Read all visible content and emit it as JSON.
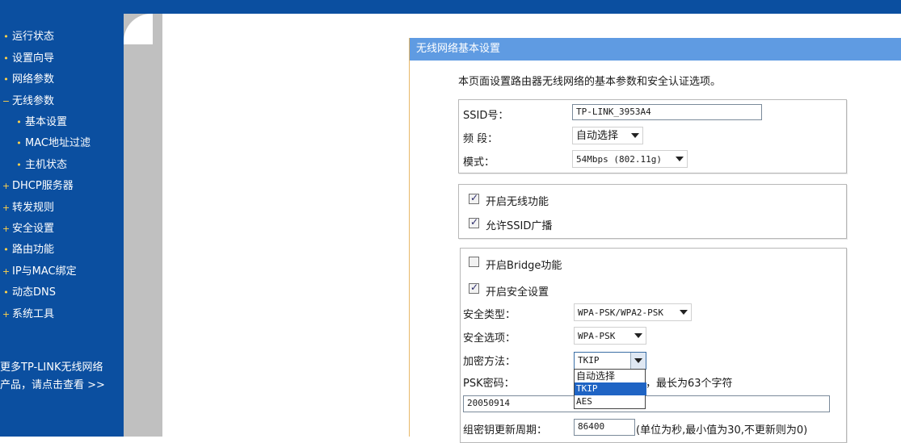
{
  "nav": {
    "items": [
      {
        "label": "运行状态",
        "marker": "•"
      },
      {
        "label": "设置向导",
        "marker": "•"
      },
      {
        "label": "网络参数",
        "marker": "•"
      },
      {
        "label": "无线参数",
        "marker": "−"
      },
      {
        "label": "基本设置",
        "marker": "•"
      },
      {
        "label": "MAC地址过滤",
        "marker": "•"
      },
      {
        "label": "主机状态",
        "marker": "•"
      },
      {
        "label": "DHCP服务器",
        "marker": "+"
      },
      {
        "label": "转发规则",
        "marker": "+"
      },
      {
        "label": "安全设置",
        "marker": "+"
      },
      {
        "label": "路由功能",
        "marker": "•"
      },
      {
        "label": "IP与MAC绑定",
        "marker": "+"
      },
      {
        "label": "动态DNS",
        "marker": "•"
      },
      {
        "label": "系统工具",
        "marker": "+"
      }
    ],
    "promo_line1": "更多TP-LINK无线网络",
    "promo_line2": "产品，请点击查看 >>"
  },
  "panel": {
    "title": "无线网络基本设置",
    "description": "本页面设置路由器无线网络的基本参数和安全认证选项。"
  },
  "basic": {
    "ssid_label": "SSID号：",
    "ssid_value": "TP-LINK_3953A4",
    "band_label": "频 段：",
    "band_value": "自动选择",
    "mode_label": "模式：",
    "mode_value": "54Mbps (802.11g)"
  },
  "wireless": {
    "enable_label": "开启无线功能",
    "enable_checked": true,
    "ssid_broadcast_label": "允许SSID广播",
    "ssid_broadcast_checked": true
  },
  "security": {
    "bridge_label": "开启Bridge功能",
    "bridge_checked": false,
    "enable_security_label": "开启安全设置",
    "enable_security_checked": true,
    "type_label": "安全类型：",
    "type_value": "WPA-PSK/WPA2-PSK",
    "option_label": "安全选项：",
    "option_value": "WPA-PSK",
    "cipher_label": "加密方法：",
    "cipher_value": "TKIP",
    "cipher_options": [
      "自动选择",
      "TKIP",
      "AES"
    ],
    "psk_label": "PSK密码：",
    "psk_hint_suffix": "，最长为63个字符",
    "psk_value": "20050914",
    "rekey_label": "组密钥更新周期：",
    "rekey_value": "86400",
    "rekey_note": "(单位为秒,最小值为30,不更新则为0)"
  },
  "colors": {
    "sidebar_bg": "#0b4fa0",
    "header_bg": "#5f9be2",
    "selected_option_bg": "#1f64c4"
  }
}
